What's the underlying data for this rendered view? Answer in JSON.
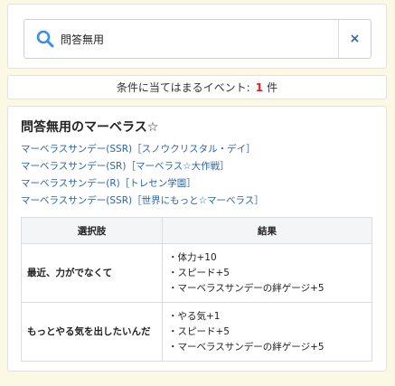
{
  "search": {
    "value": "問答無用",
    "placeholder": "",
    "clear_label": "×"
  },
  "result_count": {
    "prefix": "条件に当てはまるイベント:",
    "count": "1",
    "suffix": "件"
  },
  "event": {
    "title": "問答無用のマーベラス☆",
    "characters": [
      "マーベラスサンデー(SSR)［スノウクリスタル・デイ］",
      "マーベラスサンデー(SR)［マーベラス☆大作戦］",
      "マーベラスサンデー(R)［トレセン学園］",
      "マーベラスサンデー(SSR)［世界にもっと☆マーベラス］"
    ],
    "table": {
      "headers": [
        "選択肢",
        "結果"
      ],
      "rows": [
        {
          "choice": "最近、力がでなくて",
          "effects": [
            "・体力+10",
            "・スピード+5",
            "・マーベラスサンデーの絆ゲージ+5"
          ]
        },
        {
          "choice": "もっとやる気を出したいんだ",
          "effects": [
            "・やる気+1",
            "・スピード+5",
            "・マーベラスサンデーの絆ゲージ+5"
          ]
        }
      ]
    }
  },
  "colors": {
    "background": "#fbf9e4",
    "link": "#2b64a8",
    "count_highlight": "#e02020",
    "search_icon": "#3a8ee6"
  }
}
